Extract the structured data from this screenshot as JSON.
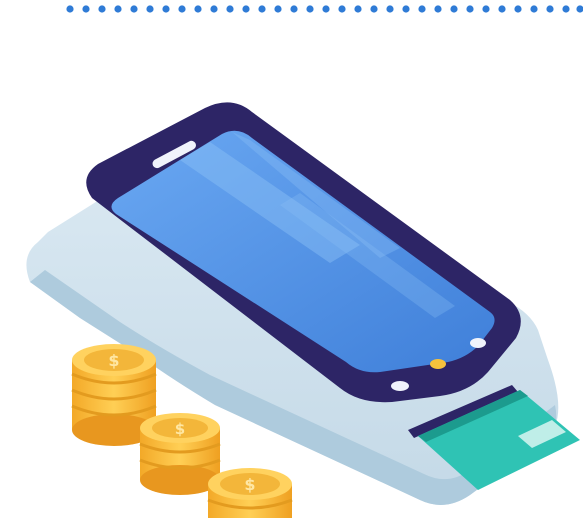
{
  "illustration": {
    "subject": "payment-terminal-with-coins-and-card",
    "icons": [
      "dotted-line-icon",
      "pos-terminal-icon",
      "smartphone-screen-icon",
      "coin-stack-icon",
      "bank-card-icon"
    ],
    "colors": {
      "dots": "#2f7bd6",
      "terminal_base": "#cfe1ec",
      "terminal_shadow": "#a9c8da",
      "phone_frame": "#2d2566",
      "screen": "#4d8fe6",
      "screen_light": "#7fb3f3",
      "coin_gold": "#f6b73c",
      "coin_shade": "#e39b1f",
      "card": "#2fc3b4",
      "card_stripe": "#1c9b8e"
    }
  }
}
